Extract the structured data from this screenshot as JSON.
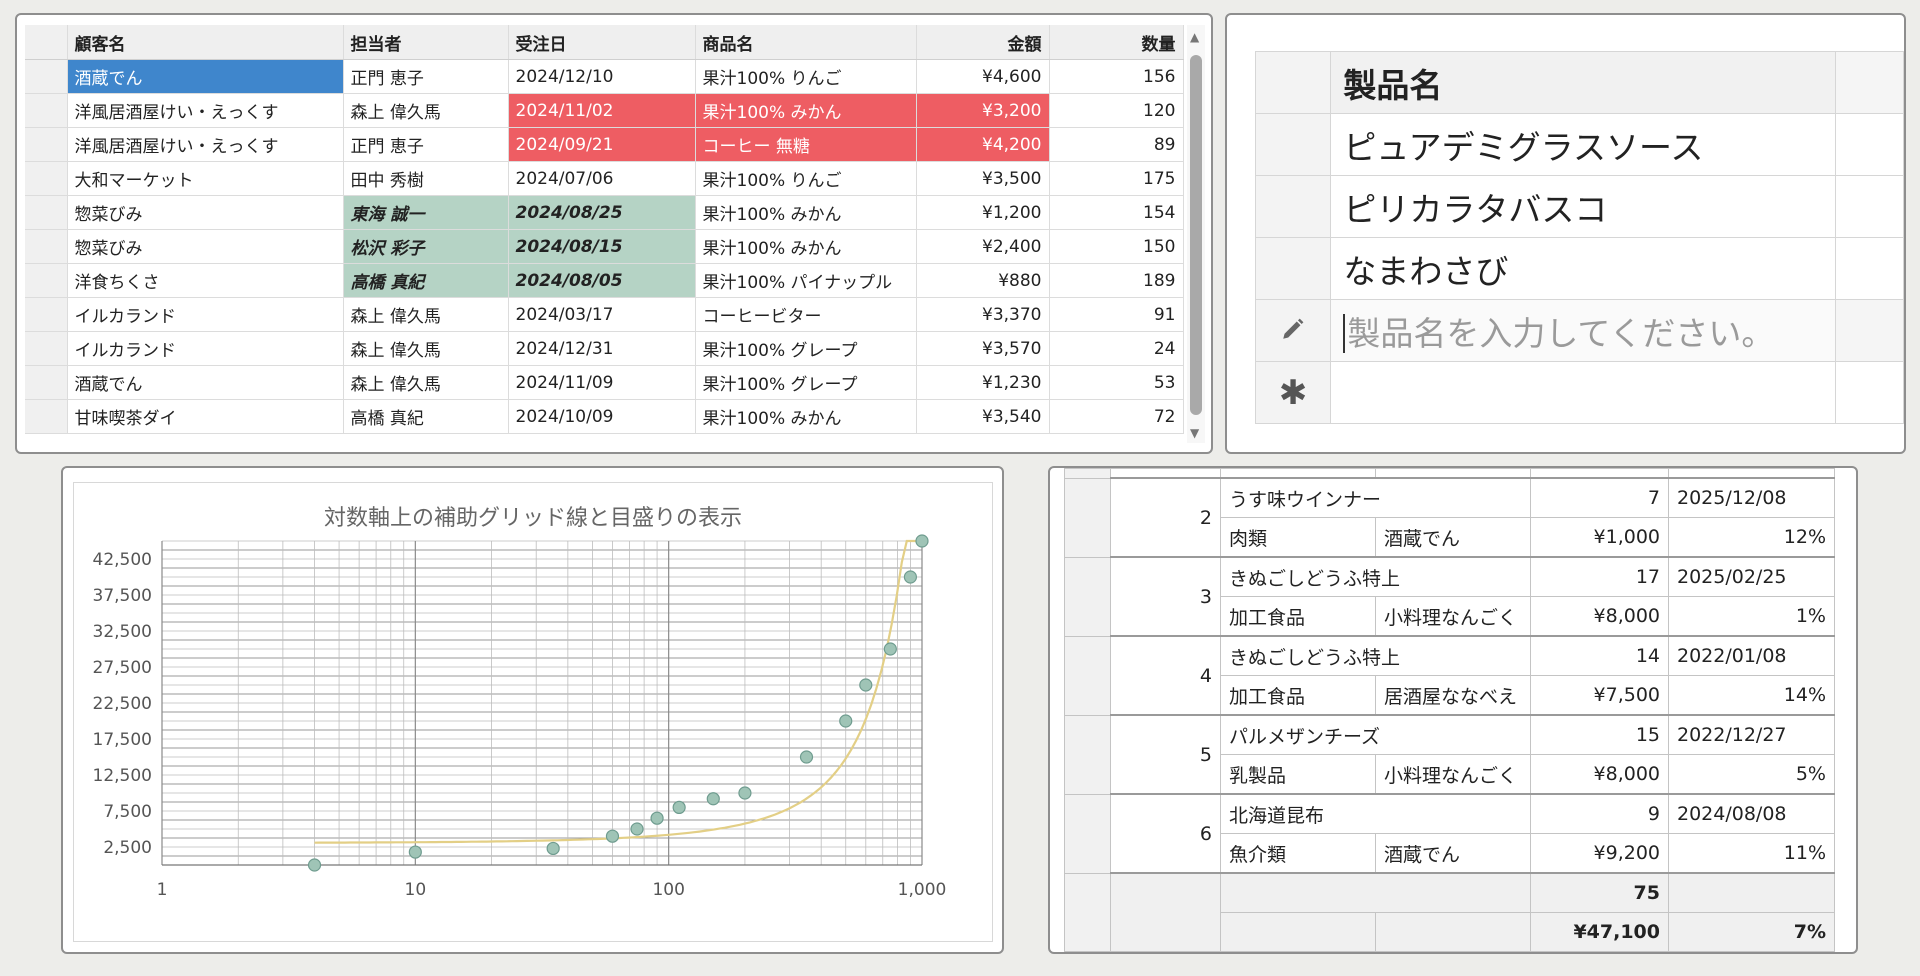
{
  "orders_grid": {
    "columns": [
      "顧客名",
      "担当者",
      "受注日",
      "商品名",
      "金額",
      "数量"
    ],
    "rows": [
      [
        "酒蔵でん",
        "正門 恵子",
        "2024/12/10",
        "果汁100% りんご",
        "¥4,600",
        "156"
      ],
      [
        "洋風居酒屋けい・えっくす",
        "森上 偉久馬",
        "2024/11/02",
        "果汁100% みかん",
        "¥3,200",
        "120"
      ],
      [
        "洋風居酒屋けい・えっくす",
        "正門 恵子",
        "2024/09/21",
        "コーヒー 無糖",
        "¥4,200",
        "89"
      ],
      [
        "大和マーケット",
        "田中 秀樹",
        "2024/07/06",
        "果汁100% りんご",
        "¥3,500",
        "175"
      ],
      [
        "惣菜びみ",
        "東海 誠一",
        "2024/08/25",
        "果汁100% みかん",
        "¥1,200",
        "154"
      ],
      [
        "惣菜びみ",
        "松沢 彩子",
        "2024/08/15",
        "果汁100% みかん",
        "¥2,400",
        "150"
      ],
      [
        "洋食ちくさ",
        "高橋 真紀",
        "2024/08/05",
        "果汁100% パイナップル",
        "¥880",
        "189"
      ],
      [
        "イルカランド",
        "森上 偉久馬",
        "2024/03/17",
        "コーヒービター",
        "¥3,370",
        "91"
      ],
      [
        "イルカランド",
        "森上 偉久馬",
        "2024/12/31",
        "果汁100% グレープ",
        "¥3,570",
        "24"
      ],
      [
        "酒蔵でん",
        "森上 偉久馬",
        "2024/11/09",
        "果汁100% グレープ",
        "¥1,230",
        "53"
      ],
      [
        "甘味喫茶ダイ",
        "高橋 真紀",
        "2024/10/09",
        "果汁100% みかん",
        "¥3,540",
        "72"
      ]
    ]
  },
  "product_entry": {
    "header": "製品名",
    "rows": [
      "ピュアデミグラスソース",
      "ピリカラタバスコ",
      "なまわさび"
    ],
    "input_placeholder": "製品名を入力してください。",
    "edit_icon": "pencil-icon",
    "new_row_icon": "asterisk-icon"
  },
  "chart_data": {
    "type": "scatter",
    "title": "対数軸上の補助グリッド線と目盛りの表示",
    "x_scale": "log",
    "xlim": [
      1,
      1000
    ],
    "ylim": [
      0,
      45000
    ],
    "x_ticks": [
      "1",
      "10",
      "100",
      "1,000"
    ],
    "y_ticks": [
      "2,500",
      "7,500",
      "12,500",
      "17,500",
      "22,500",
      "27,500",
      "32,500",
      "37,500",
      "42,500"
    ],
    "grid": true,
    "minor_grid": true,
    "points": [
      {
        "x": 4,
        "y": 0
      },
      {
        "x": 10,
        "y": 1800
      },
      {
        "x": 35,
        "y": 2300
      },
      {
        "x": 60,
        "y": 4000
      },
      {
        "x": 75,
        "y": 5000
      },
      {
        "x": 90,
        "y": 6500
      },
      {
        "x": 110,
        "y": 8000
      },
      {
        "x": 150,
        "y": 9200
      },
      {
        "x": 200,
        "y": 10000
      },
      {
        "x": 350,
        "y": 15000
      },
      {
        "x": 500,
        "y": 20000
      },
      {
        "x": 600,
        "y": 25000
      },
      {
        "x": 750,
        "y": 30000
      },
      {
        "x": 900,
        "y": 40000
      },
      {
        "x": 1000,
        "y": 45000
      }
    ],
    "trendline": true,
    "colors": {
      "marker_fill": "#9fc4b6",
      "marker_stroke": "#6f9c8f",
      "trendline": "#e3cf86",
      "grid": "#9a9a9a"
    }
  },
  "summary_grid": {
    "records": [
      {
        "no": "2",
        "name": "うす味ウインナー",
        "qty": "7",
        "date": "2025/12/08",
        "category": "肉類",
        "customer": "酒蔵でん",
        "price": "¥1,000",
        "rate": "12%"
      },
      {
        "no": "3",
        "name": "きぬごしどうふ特上",
        "qty": "17",
        "date": "2025/02/25",
        "category": "加工食品",
        "customer": "小料理なんごく",
        "price": "¥8,000",
        "rate": "1%"
      },
      {
        "no": "4",
        "name": "きぬごしどうふ特上",
        "qty": "14",
        "date": "2022/01/08",
        "category": "加工食品",
        "customer": "居酒屋ななべえ",
        "price": "¥7,500",
        "rate": "14%"
      },
      {
        "no": "5",
        "name": "パルメザンチーズ",
        "qty": "15",
        "date": "2022/12/27",
        "category": "乳製品",
        "customer": "小料理なんごく",
        "price": "¥8,000",
        "rate": "5%"
      },
      {
        "no": "6",
        "name": "北海道昆布",
        "qty": "9",
        "date": "2024/08/08",
        "category": "魚介類",
        "customer": "酒蔵でん",
        "price": "¥9,200",
        "rate": "11%"
      }
    ],
    "footer": {
      "qty_total": "75",
      "price_total": "¥47,100",
      "rate_total": "7%"
    }
  }
}
